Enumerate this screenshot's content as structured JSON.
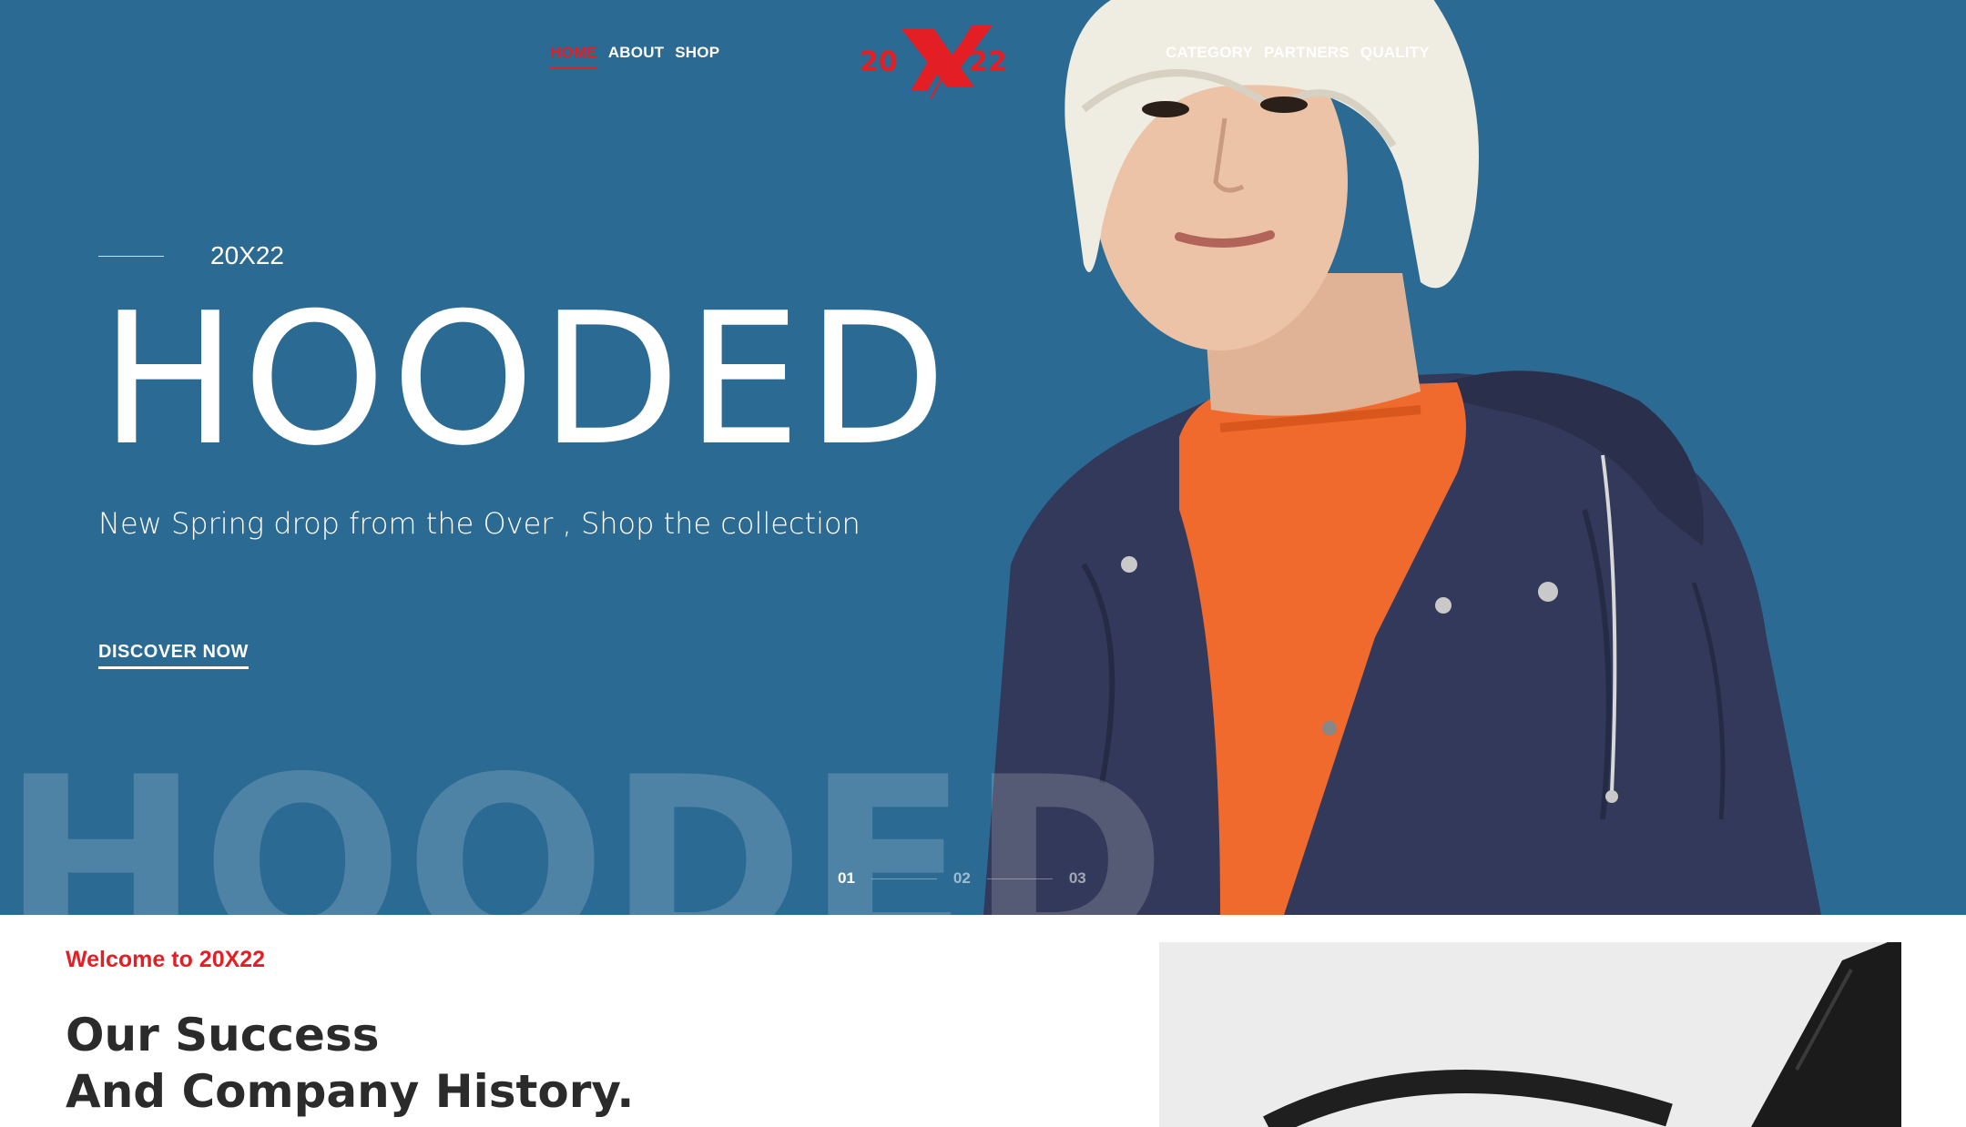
{
  "nav": {
    "left": [
      {
        "label": "HOME",
        "active": true
      },
      {
        "label": "ABOUT",
        "active": false
      },
      {
        "label": "SHOP",
        "active": false
      }
    ],
    "right": [
      {
        "label": "CATEGORY"
      },
      {
        "label": "PARTNERS"
      },
      {
        "label": "QUALITY"
      }
    ]
  },
  "logo": {
    "left": "20",
    "right": "22",
    "icon": "x-logo-icon"
  },
  "hero": {
    "kicker": "20X22",
    "headline": "HOODED",
    "subtitle": "New Spring drop from the Over , Shop the collection",
    "cta": "DISCOVER NOW",
    "ghost_text": "HOODED",
    "slides": [
      "01",
      "02",
      "03"
    ],
    "active_slide": "01"
  },
  "about": {
    "welcome": "Welcome to 20X22",
    "title_line1": "Our Success",
    "title_line2": "And Company History."
  },
  "colors": {
    "accent": "#e31e24",
    "hero_bg": "#2b6a93",
    "text_dark": "#2b2b2b"
  }
}
